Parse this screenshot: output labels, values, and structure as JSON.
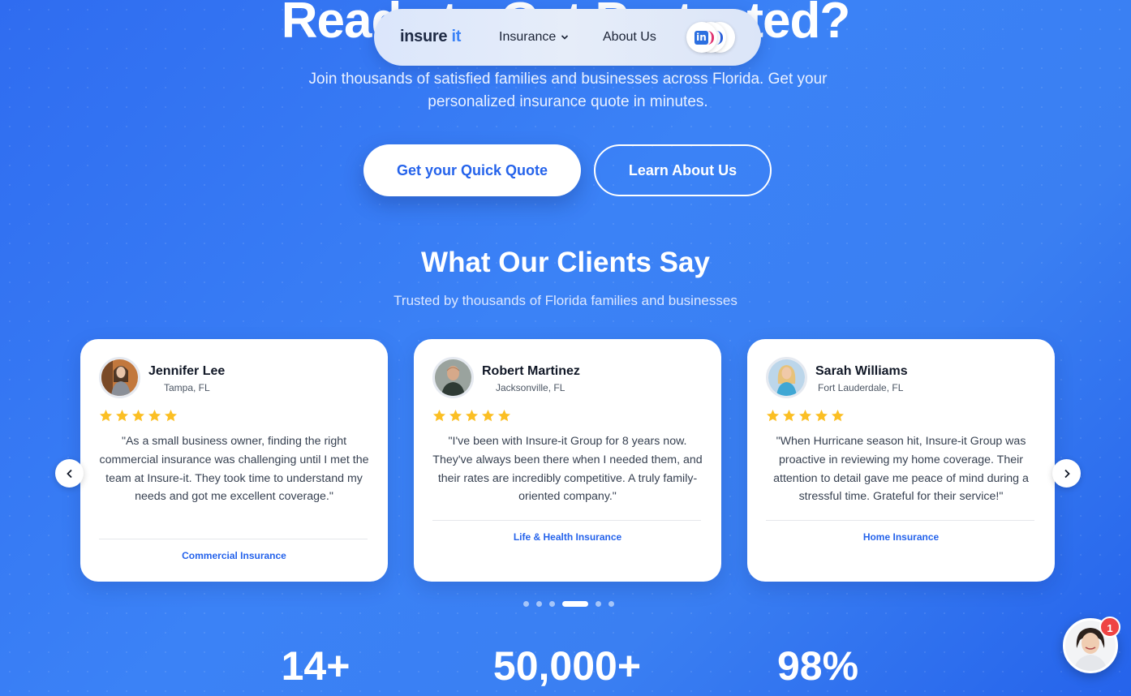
{
  "hero": {
    "title": "Ready to Get Protected?",
    "subtitle": "Join thousands of satisfied families and businesses across Florida. Get your personalized insurance quote in minutes.",
    "cta_primary": "Get your Quick Quote",
    "cta_secondary": "Learn About Us"
  },
  "navbar": {
    "logo_main": "insure",
    "logo_accent": "it",
    "insurance_label": "Insurance",
    "about_label": "About Us"
  },
  "testimonials": {
    "title": "What Our Clients Say",
    "subtitle": "Trusted by thousands of Florida families and businesses",
    "rating_stars": 5,
    "cards": [
      {
        "name": "Jennifer Lee",
        "location": "Tampa, FL",
        "quote": "\"As a small business owner, finding the right commercial insurance was challenging until I met the team at Insure-it. They took time to understand my needs and got me excellent coverage.\"",
        "category": "Commercial Insurance"
      },
      {
        "name": "Robert Martinez",
        "location": "Jacksonville, FL",
        "quote": "\"I've been with Insure-it Group for 8 years now. They've always been there when I needed them, and their rates are incredibly competitive. A truly family-oriented company.\"",
        "category": "Life & Health Insurance"
      },
      {
        "name": "Sarah Williams",
        "location": "Fort Lauderdale, FL",
        "quote": "\"When Hurricane season hit, Insure-it Group was proactive in reviewing my home coverage. Their attention to detail gave me peace of mind during a stressful time. Grateful for their service!\"",
        "category": "Home Insurance"
      }
    ],
    "pagination": {
      "total": 6,
      "active": 4
    }
  },
  "stats": [
    {
      "value": "14+"
    },
    {
      "value": "50,000+"
    },
    {
      "value": "98%"
    }
  ],
  "chat": {
    "unread_count": "1"
  },
  "colors": {
    "accent": "#2563eb",
    "star": "#fbbf24",
    "badge": "#ef4444"
  }
}
